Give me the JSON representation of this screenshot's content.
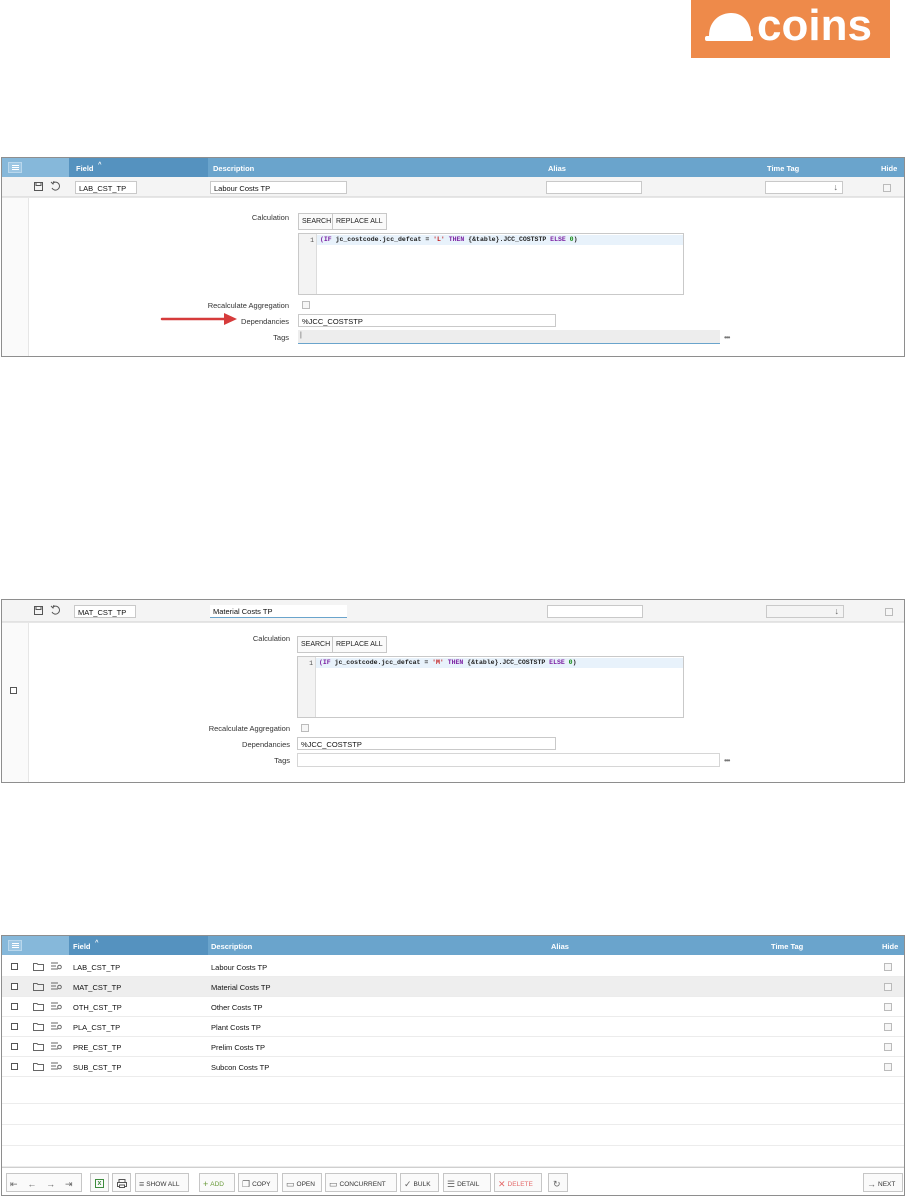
{
  "logo": {
    "text": "coins",
    "color": "#ee8a4a"
  },
  "panel1": {
    "headers": {
      "field": "Field",
      "sort": "^",
      "description": "Description",
      "alias": "Alias",
      "time_tag": "Time Tag",
      "hide": "Hide"
    },
    "row": {
      "field": "LAB_CST_TP",
      "description": "Labour Costs TP",
      "alias": "",
      "time_tag": ""
    },
    "detail": {
      "calculation_label": "Calculation",
      "search_button": "SEARCH",
      "replace_all_button": "REPLACE ALL",
      "code_line_number": "1",
      "code_parts": [
        "(IF",
        " jc_costcode.jcc_defcat = ",
        "'L'",
        " THEN",
        " {&table}.JCC_COSTSTP",
        " ELSE",
        " 0",
        ")"
      ],
      "recalculate_label": "Recalculate Aggregation",
      "dependancies_label": "Dependancies",
      "dependancies_value": "%JCC_COSTSTP",
      "tags_label": "Tags",
      "tags_value": "|",
      "more": "•••"
    }
  },
  "panel2": {
    "row": {
      "field": "MAT_CST_TP",
      "description": "Material Costs TP",
      "alias": "",
      "time_tag": ""
    },
    "detail": {
      "calculation_label": "Calculation",
      "search_button": "SEARCH",
      "replace_all_button": "REPLACE ALL",
      "code_line_number": "1",
      "code_parts": [
        "(IF",
        " jc_costcode.jcc_defcat = ",
        "'M'",
        " THEN",
        " {&table}.JCC_COSTSTP",
        " ELSE",
        " 0",
        ")"
      ],
      "recalculate_label": "Recalculate Aggregation",
      "dependancies_label": "Dependancies",
      "dependancies_value": "%JCC_COSTSTP",
      "tags_label": "Tags",
      "tags_value": "",
      "more": "•••"
    }
  },
  "panel3": {
    "headers": {
      "field": "Field",
      "sort": "^",
      "description": "Description",
      "alias": "Alias",
      "time_tag": "Time Tag",
      "hide": "Hide"
    },
    "rows": [
      {
        "field": "LAB_CST_TP",
        "description": "Labour Costs TP"
      },
      {
        "field": "MAT_CST_TP",
        "description": "Material Costs TP"
      },
      {
        "field": "OTH_CST_TP",
        "description": "Other Costs TP"
      },
      {
        "field": "PLA_CST_TP",
        "description": "Plant Costs TP"
      },
      {
        "field": "PRE_CST_TP",
        "description": "Prelim Costs TP"
      },
      {
        "field": "SUB_CST_TP",
        "description": "Subcon Costs TP"
      }
    ],
    "toolbar": {
      "show_all": "SHOW ALL",
      "add": "ADD",
      "copy": "COPY",
      "open": "OPEN",
      "concurrent": "CONCURRENT",
      "bulk": "BULK",
      "detail": "DETAIL",
      "delete": "DELETE",
      "next": "NEXT"
    }
  }
}
